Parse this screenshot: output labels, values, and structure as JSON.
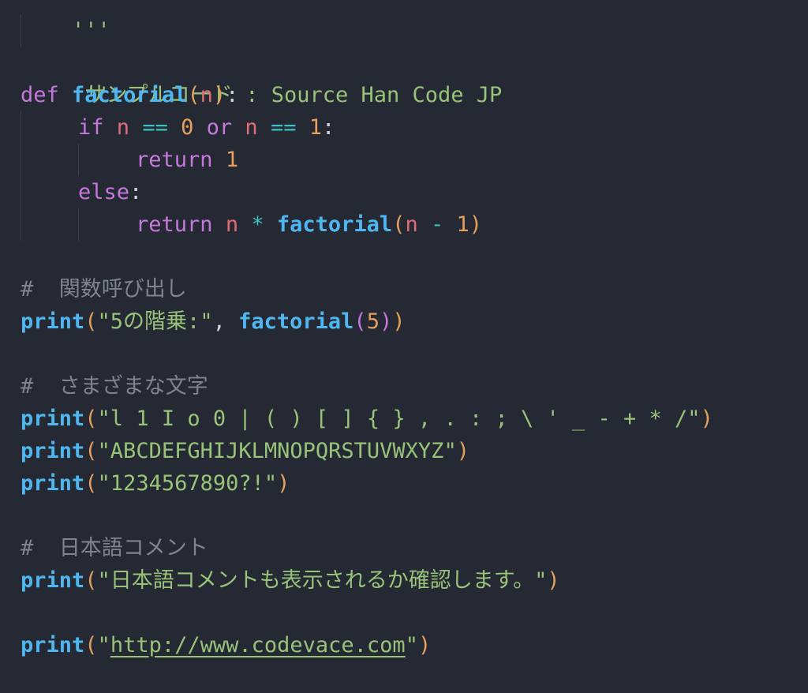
{
  "editor": {
    "language": "python",
    "colors": {
      "background": "#242933",
      "keyword": "#c678dd",
      "function": "#4fb6ef",
      "variable": "#e06c75",
      "number": "#e5a05c",
      "operator": "#3fc1c0",
      "string": "#98c379",
      "comment": "#7f848e"
    },
    "lines": {
      "l1": {
        "doc_open": "'''"
      },
      "l2": {
        "doc_text": " サンプルコード : Source Han Code JP"
      },
      "l3": {
        "doc_close": "'''"
      },
      "l4": {
        "kw_def": "def",
        "fn_name": "factorial",
        "lparen": "(",
        "param": "n",
        "rparen": ")",
        "colon": ":"
      },
      "l5": {
        "kw_if": "if",
        "var1": "n",
        "op1": "==",
        "num1": "0",
        "kw_or": "or",
        "var2": "n",
        "op2": "==",
        "num2": "1",
        "colon": ":"
      },
      "l6": {
        "kw_return": "return",
        "num": "1"
      },
      "l7": {
        "kw_else": "else",
        "colon": ":"
      },
      "l8": {
        "kw_return": "return",
        "var1": "n",
        "op": "*",
        "fn_name": "factorial",
        "lparen": "(",
        "var2": "n",
        "minus": "-",
        "num": "1",
        "rparen": ")"
      },
      "l10": {
        "comment": "#  関数呼び出し"
      },
      "l11": {
        "fn_print": "print",
        "lparen": "(",
        "str": "\"5の階乗:\"",
        "comma": ",",
        "fn_name": "factorial",
        "lparen2": "(",
        "num": "5",
        "rparen2": ")",
        "rparen": ")"
      },
      "l13": {
        "comment": "#  さまざまな文字"
      },
      "l14": {
        "fn_print": "print",
        "lparen": "(",
        "str": "\"l 1 I o 0 | ( ) [ ] { } , . : ; \\ ' _ - + * /\"",
        "rparen": ")"
      },
      "l15": {
        "fn_print": "print",
        "lparen": "(",
        "str": "\"ABCDEFGHIJKLMNOPQRSTUVWXYZ\"",
        "rparen": ")"
      },
      "l16": {
        "fn_print": "print",
        "lparen": "(",
        "str": "\"1234567890?!\"",
        "rparen": ")"
      },
      "l18": {
        "comment": "#  日本語コメント"
      },
      "l19": {
        "fn_print": "print",
        "lparen": "(",
        "str": "\"日本語コメントも表示されるか確認します。\"",
        "rparen": ")"
      },
      "l21": {
        "fn_print": "print",
        "lparen": "(",
        "quote_open": "\"",
        "url": "http://www.codevace.com",
        "quote_close": "\"",
        "rparen": ")"
      }
    }
  }
}
